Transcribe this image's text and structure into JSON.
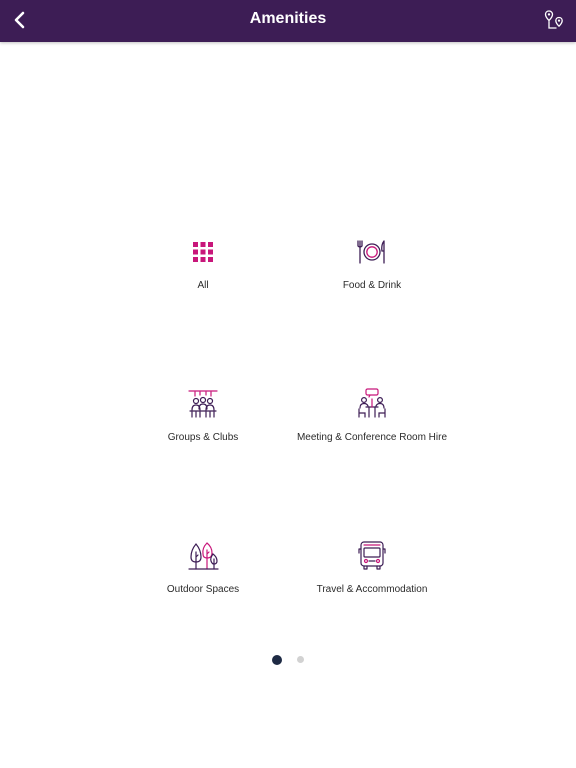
{
  "header": {
    "title": "Amenities",
    "back_icon": "chevron-left-icon",
    "map_icon": "map-pins-icon",
    "background": "#3d1d55"
  },
  "categories": [
    {
      "label": "All",
      "icon": "grid-icon"
    },
    {
      "label": "Food & Drink",
      "icon": "plate-cutlery-icon"
    },
    {
      "label": "Groups & Clubs",
      "icon": "people-group-icon"
    },
    {
      "label": "Meeting & Conference Room Hire",
      "icon": "meeting-table-icon"
    },
    {
      "label": "Outdoor Spaces",
      "icon": "trees-icon"
    },
    {
      "label": "Travel & Accommodation",
      "icon": "bus-icon"
    }
  ],
  "pagination": {
    "pages": 2,
    "current": 1
  },
  "colors": {
    "accent": "#c8167a",
    "icon_stroke": "#3d1d55",
    "dot_active": "#1e2a44",
    "dot_inactive": "#d2d2d2"
  }
}
